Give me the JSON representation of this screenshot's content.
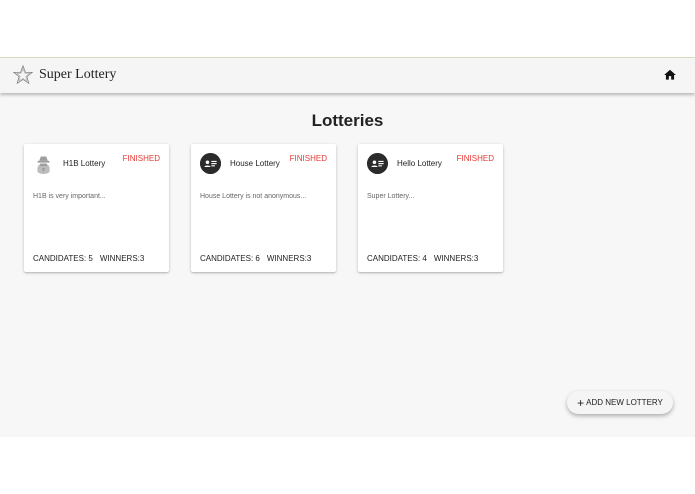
{
  "header": {
    "title": "Super Lottery",
    "logo_icon": "star-outline-icon",
    "home_icon": "home-icon"
  },
  "main": {
    "title": "Lotteries"
  },
  "lotteries": [
    {
      "name": "H1B Lottery",
      "status": "FINISHED",
      "description": "H1B is very important...",
      "candidates_label": "CANDIDATES: 5",
      "winners_label": "WINNERS:3",
      "avatar_icon": "spy-icon"
    },
    {
      "name": "House Lottery",
      "status": "FINISHED",
      "description": "House Lottery is not anonymous...",
      "candidates_label": "CANDIDATES: 6",
      "winners_label": "WINNERS:3",
      "avatar_icon": "contact-card-icon"
    },
    {
      "name": "Hello Lottery",
      "status": "FINISHED",
      "description": "Super Lottery...",
      "candidates_label": "CANDIDATES: 4",
      "winners_label": "WINNERS:3",
      "avatar_icon": "contact-card-icon"
    }
  ],
  "fab": {
    "label": "ADD NEW LOTTERY",
    "icon": "plus-icon"
  },
  "colors": {
    "status_finished": "#e53935",
    "header_bg": "#f5f5f5",
    "page_bg": "#f7f7f7"
  }
}
